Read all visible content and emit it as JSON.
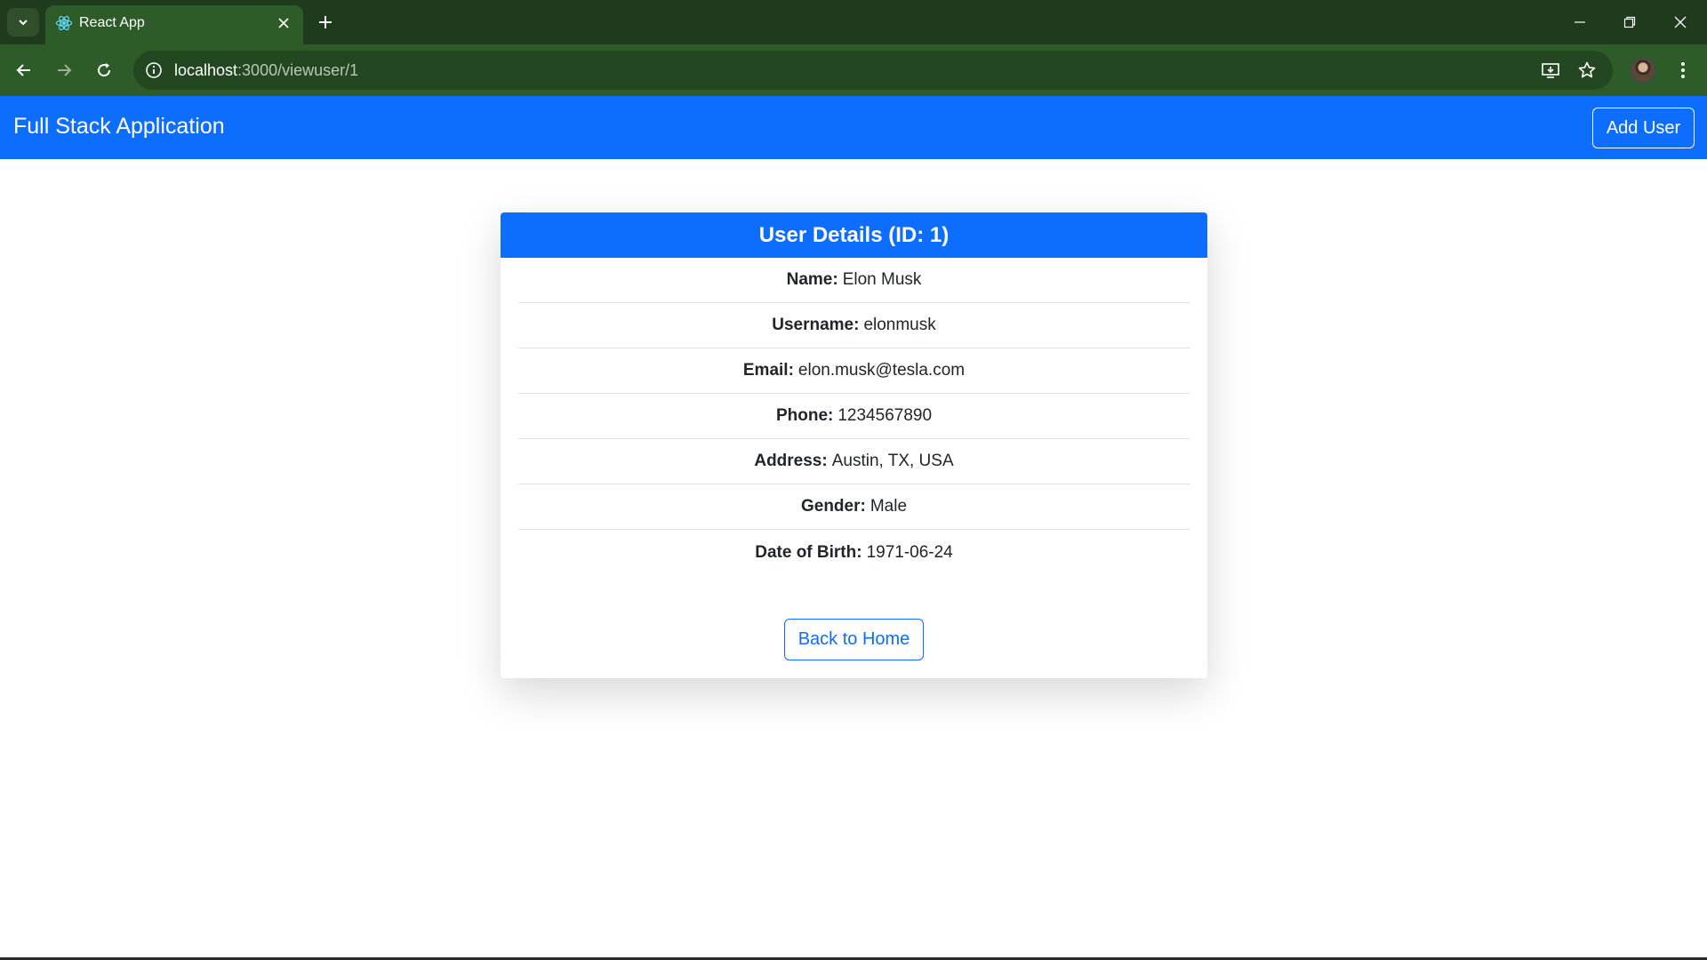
{
  "browser": {
    "tab_title": "React App",
    "url_host": "localhost",
    "url_path": ":3000/viewuser/1"
  },
  "navbar": {
    "brand": "Full Stack Application",
    "add_user_label": "Add User"
  },
  "card": {
    "title": "User Details (ID: 1)",
    "fields": [
      {
        "label": "Name:",
        "value": "Elon Musk"
      },
      {
        "label": "Username:",
        "value": "elonmusk"
      },
      {
        "label": "Email:",
        "value": "elon.musk@tesla.com"
      },
      {
        "label": "Phone:",
        "value": "1234567890"
      },
      {
        "label": "Address:",
        "value": "Austin, TX, USA"
      },
      {
        "label": "Gender:",
        "value": "Male"
      },
      {
        "label": "Date of Birth:",
        "value": "1971-06-24"
      }
    ],
    "back_label": "Back to Home"
  },
  "colors": {
    "primary": "#0d6efd",
    "chrome_dark": "#1f3a1c",
    "chrome_toolbar": "#2e5c28"
  },
  "icons": [
    "tab-search-icon",
    "react-logo-icon",
    "close-icon",
    "plus-icon",
    "minimize-icon",
    "restore-icon",
    "window-close-icon",
    "back-arrow-icon",
    "forward-arrow-icon",
    "reload-icon",
    "info-icon",
    "install-app-icon",
    "star-icon",
    "kebab-menu-icon"
  ]
}
